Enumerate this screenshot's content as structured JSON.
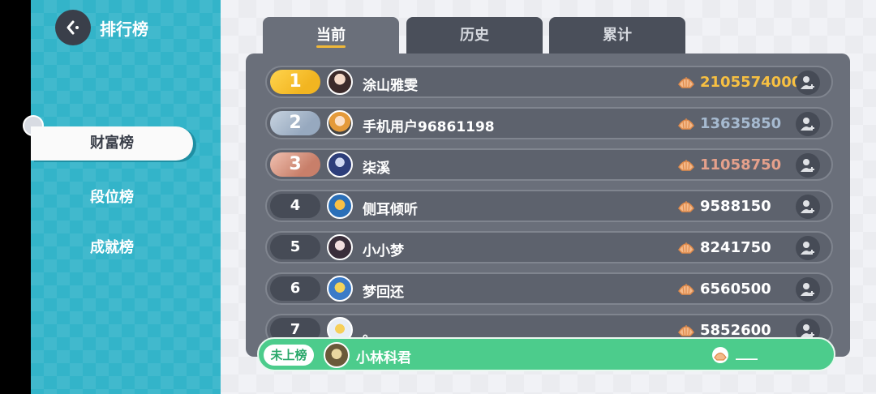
{
  "header": {
    "title": "排行榜"
  },
  "sidebar": {
    "items": [
      {
        "label": "财富榜",
        "active": true
      },
      {
        "label": "段位榜",
        "active": false
      },
      {
        "label": "成就榜",
        "active": false
      }
    ]
  },
  "tabs": [
    {
      "label": "当前",
      "active": true
    },
    {
      "label": "历史",
      "active": false
    },
    {
      "label": "累计",
      "active": false
    }
  ],
  "leaderboard": [
    {
      "rank": "1",
      "name": "涂山雅雯",
      "score": "2105574000",
      "avatar": "avatar-1-icon"
    },
    {
      "rank": "2",
      "name": "手机用户96861198",
      "score": "13635850",
      "avatar": "avatar-2-icon"
    },
    {
      "rank": "3",
      "name": "柒溪",
      "score": "11058750",
      "avatar": "avatar-3-icon"
    },
    {
      "rank": "4",
      "name": "侧耳倾听",
      "score": "9588150",
      "avatar": "avatar-4-icon"
    },
    {
      "rank": "5",
      "name": "小小梦",
      "score": "8241750",
      "avatar": "avatar-5-icon"
    },
    {
      "rank": "6",
      "name": "梦回还",
      "score": "6560500",
      "avatar": "avatar-6-icon"
    },
    {
      "rank": "7",
      "name": "。",
      "score": "5852600",
      "avatar": "avatar-7-icon"
    }
  ],
  "self": {
    "badge": "未上榜",
    "name": "小林科君",
    "score": "___"
  },
  "colors": {
    "gold": "#f7c042",
    "silver": "#a6bad0",
    "bronze": "#e5a08b",
    "accent_teal": "#33b4c9",
    "self_green": "#4ccc8c"
  },
  "icons": {
    "back": "back-arrow-icon",
    "currency": "shell-coin-icon",
    "add_friend": "add-friend-icon"
  }
}
